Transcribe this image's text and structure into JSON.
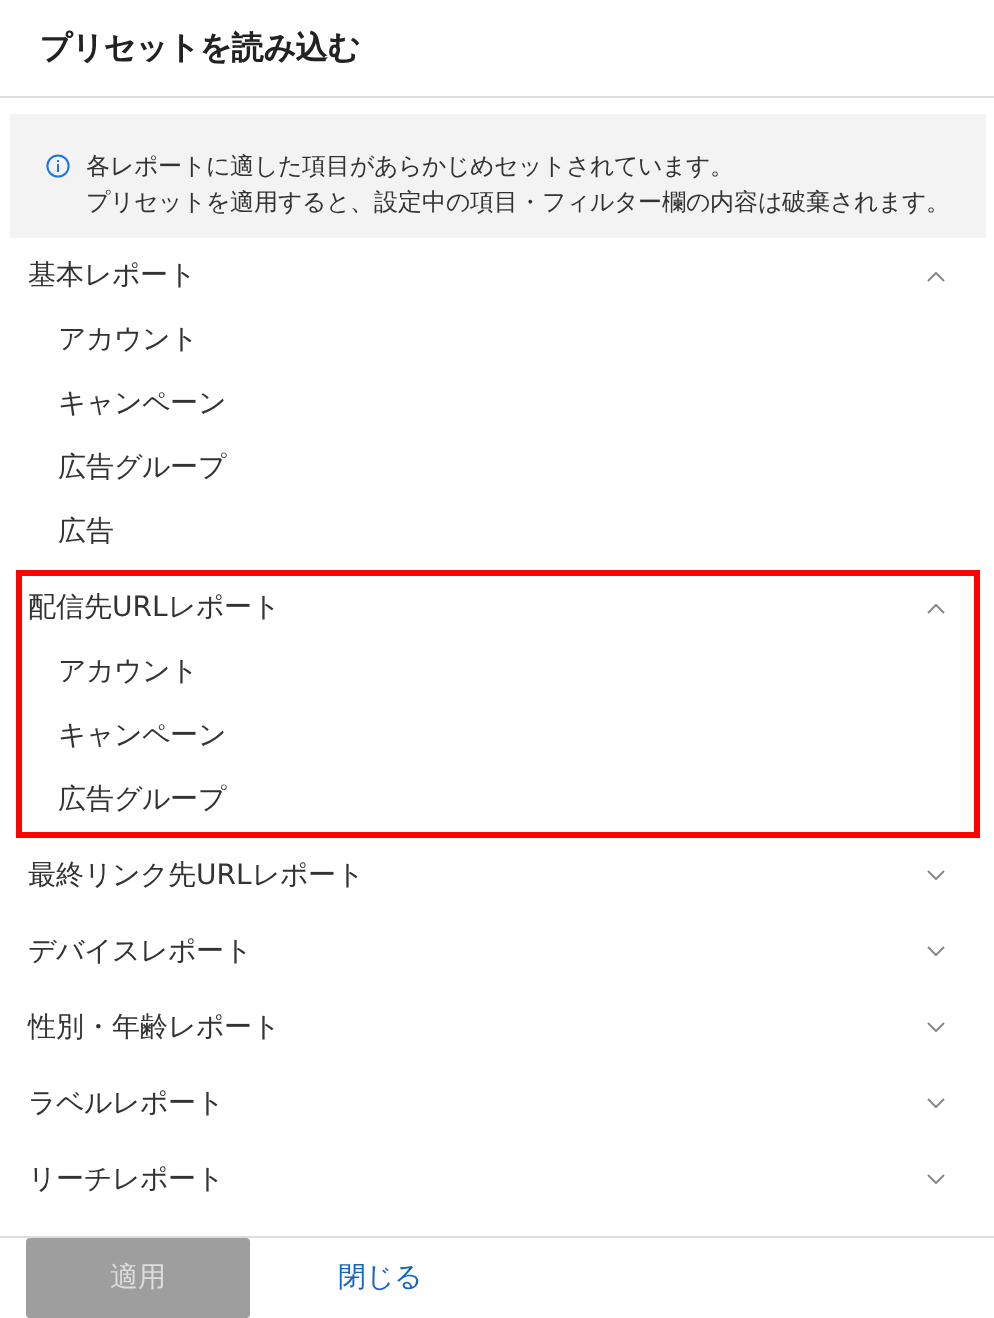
{
  "dialog": {
    "title": "プリセットを読み込む"
  },
  "notice": {
    "lines": [
      "各レポートに適した項目があらかじめセットされています。",
      "プリセットを適用すると、設定中の項目・フィルター欄の内容は破棄されます。"
    ]
  },
  "sections": [
    {
      "label": "基本レポート",
      "expanded": true,
      "highlighted": false,
      "children": [
        {
          "label": "アカウント"
        },
        {
          "label": "キャンペーン"
        },
        {
          "label": "広告グループ"
        },
        {
          "label": "広告"
        }
      ]
    },
    {
      "label": "配信先URLレポート",
      "expanded": true,
      "highlighted": true,
      "children": [
        {
          "label": "アカウント"
        },
        {
          "label": "キャンペーン"
        },
        {
          "label": "広告グループ"
        }
      ]
    },
    {
      "label": "最終リンク先URLレポート",
      "expanded": false,
      "highlighted": false
    },
    {
      "label": "デバイスレポート",
      "expanded": false,
      "highlighted": false
    },
    {
      "label": "性別・年齢レポート",
      "expanded": false,
      "highlighted": false
    },
    {
      "label": "ラベルレポート",
      "expanded": false,
      "highlighted": false
    },
    {
      "label": "リーチレポート",
      "expanded": false,
      "highlighted": false
    }
  ],
  "footer": {
    "apply": {
      "label": "適用",
      "disabled": true
    },
    "close": {
      "label": "閉じる"
    }
  }
}
